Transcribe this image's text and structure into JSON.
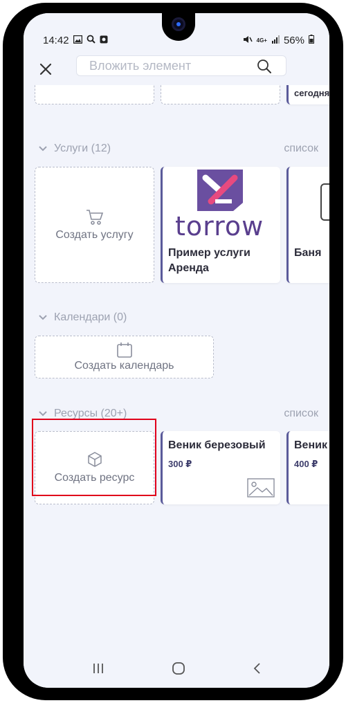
{
  "status": {
    "time": "14:42",
    "network": "4G+",
    "battery": "56%"
  },
  "search": {
    "placeholder": "Вложить элемент"
  },
  "top_partial": {
    "card3_text": "сегодня"
  },
  "services": {
    "header": "Услуги (12)",
    "link": "список",
    "create_label": "Создать услугу",
    "logo_text": "torrow",
    "item1_title": "Пример услуги Аренда",
    "item2_title": "Баня"
  },
  "calendars": {
    "header": "Календари (0)",
    "create_label": "Создать календарь"
  },
  "resources": {
    "header": "Ресурсы (20+)",
    "link": "список",
    "create_label": "Создать ресурс",
    "item1_title": "Веник березовый",
    "item1_price": "300 ₽",
    "item2_title": "Веник",
    "item2_price": "400 ₽"
  },
  "colors": {
    "accent": "#5a5a9a",
    "logo_purple": "#6a4fa0",
    "logo_pink": "#e84a7f",
    "highlight": "#e0001a"
  }
}
